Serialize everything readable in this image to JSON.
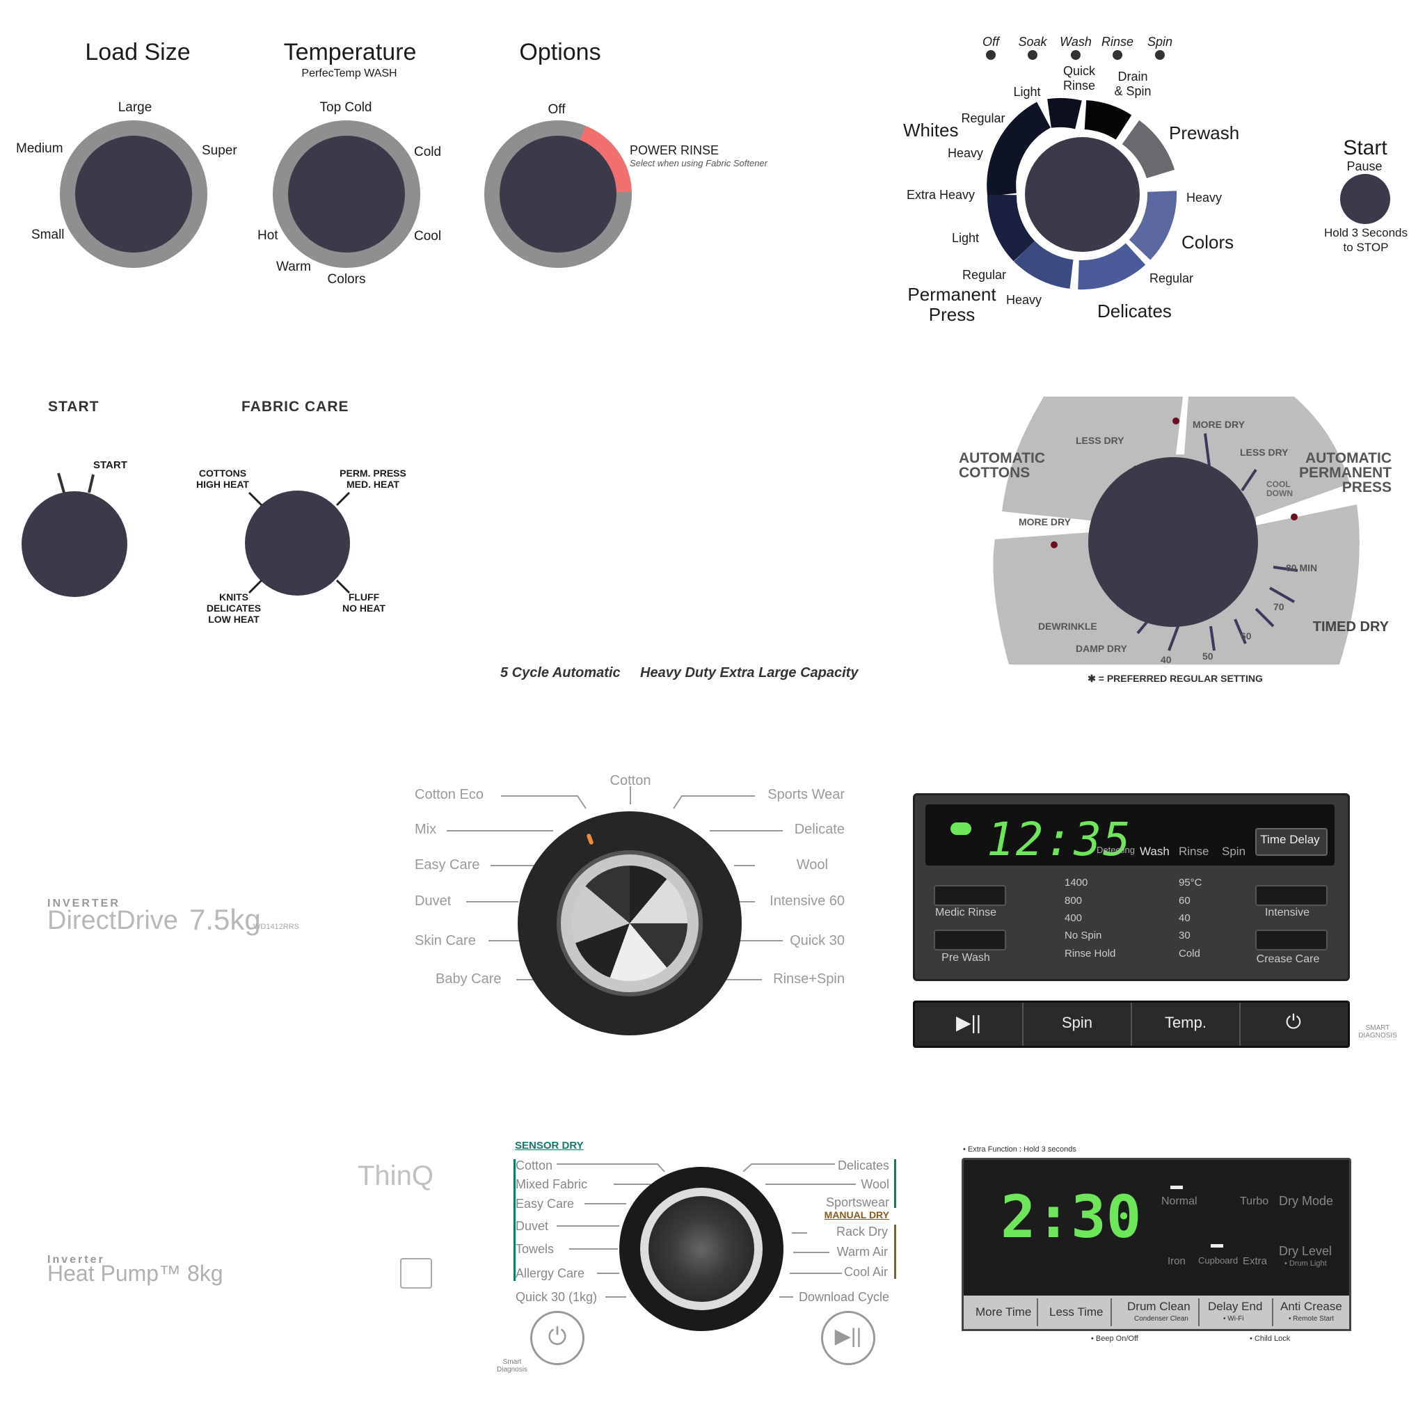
{
  "panel1": {
    "load_size": {
      "title": "Load Size",
      "labels": [
        "Large",
        "Medium",
        "Super",
        "Small"
      ]
    },
    "temperature": {
      "title": "Temperature",
      "subtitle": "PerfecTemp WASH",
      "labels": [
        "Top Cold",
        "Cold",
        "Cool",
        "Colors",
        "Warm",
        "Hot"
      ]
    },
    "options": {
      "title": "Options",
      "off": "Off",
      "power_rinse": "POWER RINSE",
      "power_rinse_note": "Select when using Fabric Softener"
    },
    "cycle": {
      "status": [
        "Off",
        "Soak",
        "Wash",
        "Rinse",
        "Spin"
      ],
      "labels": {
        "quick_rinse": "Quick\nRinse",
        "drain_spin": "Drain\n& Spin",
        "light_top": "Light",
        "regular_top": "Regular",
        "whites": "Whites",
        "heavy_left": "Heavy",
        "extra_heavy": "Extra Heavy",
        "light_left": "Light",
        "regular_left": "Regular",
        "permanent_press": "Permanent\nPress",
        "heavy_bottom": "Heavy",
        "delicates": "Delicates",
        "regular_right": "Regular",
        "colors": "Colors",
        "heavy_right": "Heavy",
        "prewash": "Prewash"
      }
    },
    "start": {
      "title": "Start",
      "pause": "Pause",
      "hold": "Hold 3 Seconds\nto STOP"
    }
  },
  "panel2": {
    "start_title": "START",
    "start_label": "START",
    "fabric_care_title": "FABRIC CARE",
    "fabric": {
      "cottons": "COTTONS\nHIGH HEAT",
      "perm": "PERM. PRESS\nMED. HEAT",
      "knits": "KNITS\nDELICATES\nLOW HEAT",
      "fluff": "FLUFF\nNO HEAT"
    },
    "footer_left": "5 Cycle Automatic",
    "footer_right": "Heavy Duty Extra Large Capacity",
    "dryer_dial": {
      "auto_cottons": "AUTOMATIC\nCOTTONS",
      "auto_perm": "AUTOMATIC\nPERMANENT\nPRESS",
      "timed_dry": "TIMED DRY",
      "less_dry_1": "LESS DRY",
      "more_dry_1": "MORE DRY",
      "less_dry_2": "LESS DRY",
      "cool_down": "COOL\nDOWN",
      "more_dry_2": "MORE DRY",
      "min80": "80 MIN",
      "t70": "70",
      "t60": "60",
      "t50": "50",
      "t40": "40",
      "damp_dry": "DAMP DRY",
      "dewrinkle": "DEWRINKLE",
      "legend": "✱ = PREFERRED REGULAR SETTING"
    }
  },
  "panel3": {
    "brand_small": "INVERTER",
    "brand_main": "DirectDrive",
    "capacity": "7.5kg",
    "model": "WD1412RRS",
    "programs_left": [
      "Cotton Eco",
      "Mix",
      "Easy Care",
      "Duvet",
      "Skin Care",
      "Baby Care"
    ],
    "programs_top": "Cotton",
    "programs_right": [
      "Sports Wear",
      "Delicate",
      "Wool",
      "Intensive 60",
      "Quick 30",
      "Rinse+Spin"
    ],
    "display": {
      "time": "12:35",
      "stages": [
        "Detecting",
        "Wash",
        "Rinse",
        "Spin"
      ],
      "time_delay": "Time Delay"
    },
    "left_buttons": [
      "Medic Rinse",
      "Pre Wash"
    ],
    "spin_speeds": [
      "1400",
      "800",
      "400",
      "No Spin",
      "Rinse Hold"
    ],
    "temps": [
      "95°C",
      "60",
      "40",
      "30",
      "Cold"
    ],
    "right_buttons": [
      "Intensive",
      "Crease Care"
    ],
    "bottom_buttons": [
      "▶||",
      "Spin",
      "Temp.",
      "⏻"
    ],
    "smart_diag": "SMART\nDIAGNOSIS"
  },
  "panel4": {
    "thinq": "ThinQ",
    "brand_small": "Inverter",
    "brand_main": "Heat Pump™ 8kg",
    "sensor_dry": "SENSOR DRY",
    "manual_dry": "MANUAL DRY",
    "programs_left": [
      "Cotton",
      "Mixed Fabric",
      "Easy Care",
      "Duvet",
      "Towels",
      "Allergy Care",
      "Quick 30 (1kg)"
    ],
    "programs_right": [
      "Delicates",
      "Wool",
      "Sportswear",
      "Rack Dry",
      "Warm Air",
      "Cool Air",
      "Download Cycle"
    ],
    "smart_diag": "Smart\nDiagnosis",
    "extra_function": "• Extra Function : Hold 3 seconds",
    "display": {
      "time": "2:30",
      "modes": [
        "Normal",
        "Turbo",
        "Dry Mode"
      ],
      "levels": [
        "Iron",
        "Cupboard",
        "Extra",
        "Dry Level"
      ],
      "dry_level_sub": "• Drum Light"
    },
    "bottom_buttons": [
      {
        "label": "More Time",
        "sub": ""
      },
      {
        "label": "Less Time",
        "sub": ""
      },
      {
        "label": "Drum Clean",
        "sub": "Condenser Clean"
      },
      {
        "label": "Delay End",
        "sub": "• Wi-Fi"
      },
      {
        "label": "Anti Crease",
        "sub": "• Remote Start"
      }
    ],
    "beep": "• Beep On/Off",
    "child_lock": "• Child Lock"
  },
  "colors": {
    "knob": "#3a3a4a",
    "ring": "#8f8f8f",
    "power_rinse": "#f26f6f",
    "lcd_green": "#6ee65a"
  }
}
